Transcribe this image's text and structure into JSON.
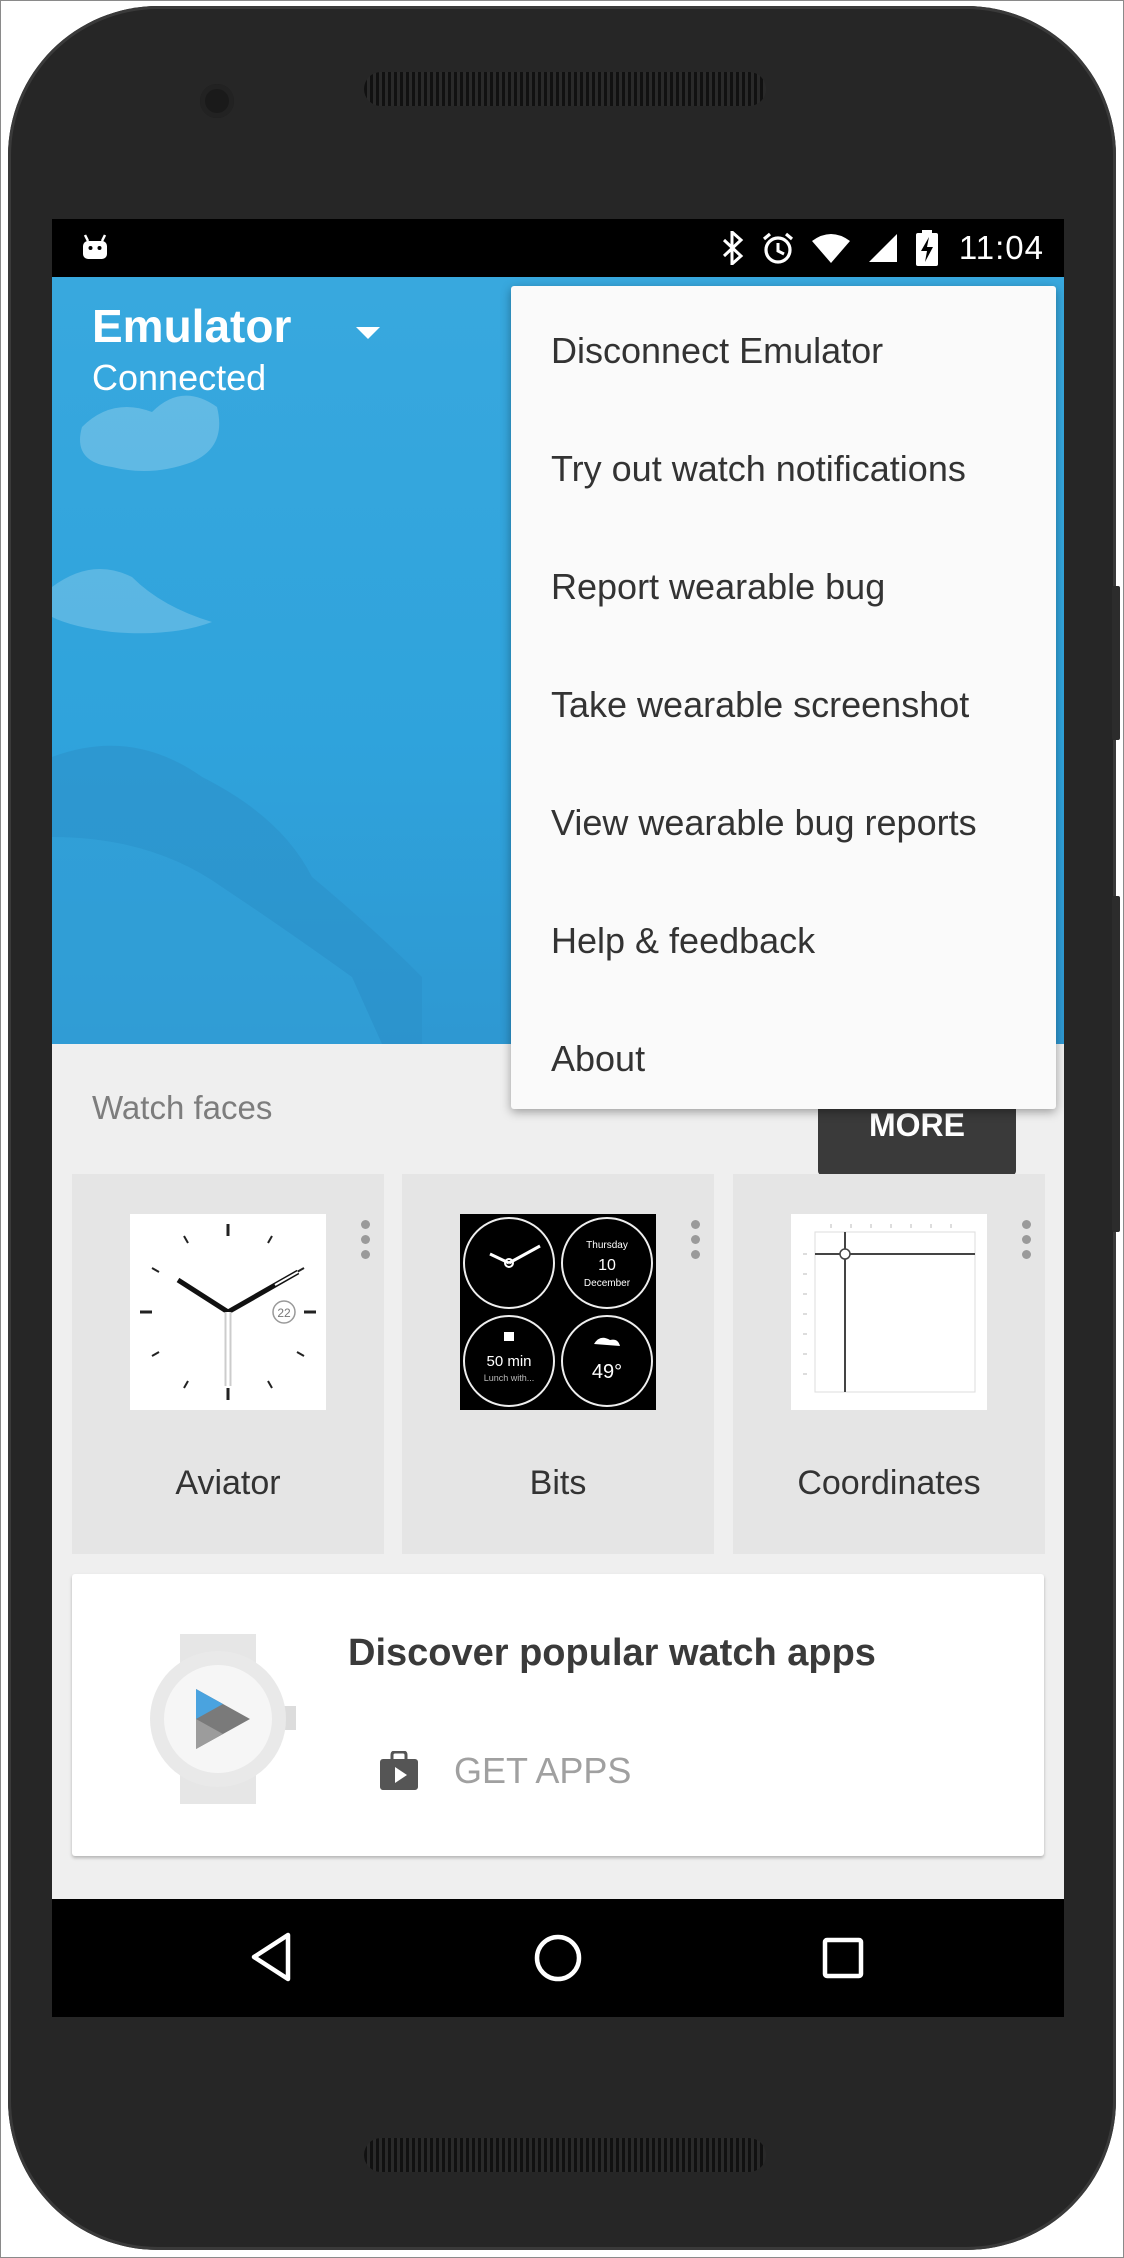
{
  "status_bar": {
    "time": "11:04",
    "icons": [
      "android-notification-icon",
      "bluetooth-icon",
      "alarm-icon",
      "wifi-icon",
      "cellular-icon",
      "battery-charging-icon"
    ]
  },
  "device": {
    "name": "Emulator",
    "status": "Connected"
  },
  "menu": {
    "items": [
      "Disconnect Emulator",
      "Try out watch notifications",
      "Report wearable bug",
      "Take wearable screenshot",
      "View wearable bug reports",
      "Help & feedback",
      "About"
    ]
  },
  "watch_faces": {
    "label": "Watch faces",
    "more_label": "MORE",
    "items": [
      {
        "name": "Aviator",
        "badge": "22"
      },
      {
        "name": "Bits",
        "day": "Thursday",
        "date": "10",
        "month": "December",
        "event_time": "50 min",
        "event_text": "Lunch with...",
        "temperature": "49°"
      },
      {
        "name": "Coordinates"
      }
    ]
  },
  "apps_card": {
    "title": "Discover popular watch apps",
    "action_label": "GET APPS"
  },
  "colors": {
    "hero": "#34a4dc",
    "screen_bg": "#efefef",
    "menu_bg": "#fafafa"
  }
}
